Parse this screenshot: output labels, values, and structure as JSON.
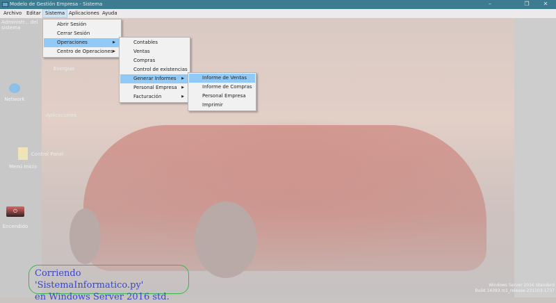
{
  "window": {
    "title": "Modelo de Gestión Empresa - Sistema",
    "minimize": "–",
    "maximize": "❐",
    "close": "✕"
  },
  "menubar": [
    "Archivo",
    "Editar",
    "Sistema",
    "Aplicaciones",
    "Ayuda"
  ],
  "sistema_menu": [
    {
      "label": "Abrir Sesión"
    },
    {
      "label": "Cerrar Sesión"
    },
    {
      "label": "Operaciones",
      "submenu": true
    },
    {
      "label": "Centro de Operaciones",
      "submenu": true
    }
  ],
  "operaciones_menu": [
    {
      "label": "Contables"
    },
    {
      "label": "Ventas"
    },
    {
      "label": "Compras"
    },
    {
      "label": "Control de existencias"
    },
    {
      "label": "Generar Informes",
      "submenu": true
    },
    {
      "label": "Personal Empresa",
      "submenu": true
    },
    {
      "label": "Facturación",
      "submenu": true
    }
  ],
  "informes_menu": [
    {
      "label": "Informe de Ventas"
    },
    {
      "label": "Informe de Compras"
    },
    {
      "label": "Personal Empresa"
    },
    {
      "label": "Imprimir"
    }
  ],
  "desktop_icons": [
    "Administr... del sistema",
    "Network",
    "Menú Inicio",
    "Encendido",
    "Energías",
    "Aplicaciones",
    "Control Panel"
  ],
  "annotation": {
    "line1": "Corriendo 'SistemaInformatico.py'",
    "line2": "en Windows Server 2016 std."
  },
  "watermark": {
    "line1": "Windows Server 2016 Standard",
    "line2": "Build 14393.rs1_release.231103-1737"
  }
}
